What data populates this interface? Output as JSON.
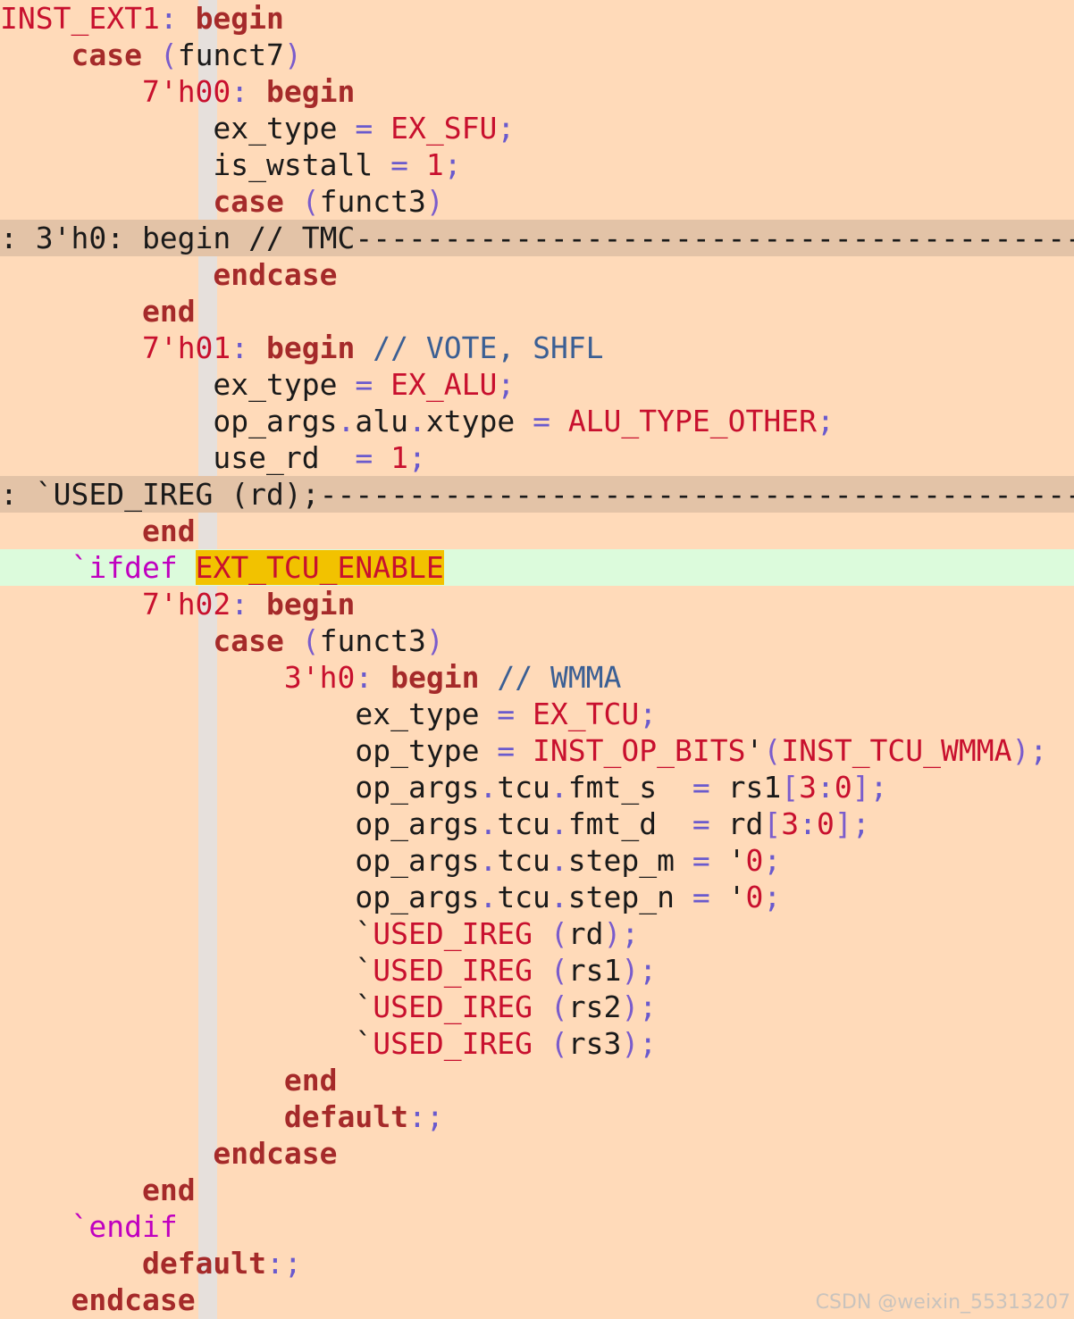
{
  "editor": {
    "watermark": "CSDN @weixin_55313207",
    "lines": [
      {
        "segs": [
          {
            "t": "INST_EXT1",
            "c": "label"
          },
          {
            "t": ": ",
            "c": "op"
          },
          {
            "t": "begin",
            "c": "kw"
          }
        ]
      },
      {
        "segs": [
          {
            "t": "    ",
            "c": "id"
          },
          {
            "t": "case",
            "c": "kw"
          },
          {
            "t": " ",
            "c": "id"
          },
          {
            "t": "(",
            "c": "paren"
          },
          {
            "t": "funct7",
            "c": "id"
          },
          {
            "t": ")",
            "c": "paren"
          }
        ]
      },
      {
        "segs": [
          {
            "t": "        ",
            "c": "id"
          },
          {
            "t": "7'h00",
            "c": "num"
          },
          {
            "t": ": ",
            "c": "op"
          },
          {
            "t": "begin",
            "c": "kw"
          }
        ]
      },
      {
        "segs": [
          {
            "t": "            ",
            "c": "id"
          },
          {
            "t": "ex_type",
            "c": "id"
          },
          {
            "t": " = ",
            "c": "op"
          },
          {
            "t": "EX_SFU",
            "c": "const"
          },
          {
            "t": ";",
            "c": "op"
          }
        ]
      },
      {
        "segs": [
          {
            "t": "            ",
            "c": "id"
          },
          {
            "t": "is_wstall",
            "c": "id"
          },
          {
            "t": " = ",
            "c": "op"
          },
          {
            "t": "1",
            "c": "num"
          },
          {
            "t": ";",
            "c": "op"
          }
        ]
      },
      {
        "segs": [
          {
            "t": "            ",
            "c": "id"
          },
          {
            "t": "case",
            "c": "kw"
          },
          {
            "t": " ",
            "c": "id"
          },
          {
            "t": "(",
            "c": "paren"
          },
          {
            "t": "funct3",
            "c": "id"
          },
          {
            "t": ")",
            "c": "paren"
          }
        ]
      },
      {
        "type": "fold",
        "segs": [
          {
            "t": ": 3'h0: begin // TMC",
            "c": "id"
          },
          {
            "t": "------------------------------------------------------------",
            "c": "id"
          }
        ]
      },
      {
        "segs": [
          {
            "t": "            ",
            "c": "id"
          },
          {
            "t": "endcase",
            "c": "kw"
          }
        ]
      },
      {
        "segs": [
          {
            "t": "        ",
            "c": "id"
          },
          {
            "t": "end",
            "c": "kw"
          }
        ]
      },
      {
        "segs": [
          {
            "t": "        ",
            "c": "id"
          },
          {
            "t": "7'h01",
            "c": "num"
          },
          {
            "t": ": ",
            "c": "op"
          },
          {
            "t": "begin",
            "c": "kw"
          },
          {
            "t": " ",
            "c": "id"
          },
          {
            "t": "// VOTE, SHFL",
            "c": "cmt"
          }
        ]
      },
      {
        "segs": [
          {
            "t": "            ",
            "c": "id"
          },
          {
            "t": "ex_type",
            "c": "id"
          },
          {
            "t": " = ",
            "c": "op"
          },
          {
            "t": "EX_ALU",
            "c": "const"
          },
          {
            "t": ";",
            "c": "op"
          }
        ]
      },
      {
        "segs": [
          {
            "t": "            ",
            "c": "id"
          },
          {
            "t": "op_args",
            "c": "id"
          },
          {
            "t": ".",
            "c": "op"
          },
          {
            "t": "alu",
            "c": "id"
          },
          {
            "t": ".",
            "c": "op"
          },
          {
            "t": "xtype",
            "c": "id"
          },
          {
            "t": " = ",
            "c": "op"
          },
          {
            "t": "ALU_TYPE_OTHER",
            "c": "const"
          },
          {
            "t": ";",
            "c": "op"
          }
        ]
      },
      {
        "segs": [
          {
            "t": "            ",
            "c": "id"
          },
          {
            "t": "use_rd",
            "c": "id"
          },
          {
            "t": "  = ",
            "c": "op"
          },
          {
            "t": "1",
            "c": "num"
          },
          {
            "t": ";",
            "c": "op"
          }
        ]
      },
      {
        "type": "fold",
        "segs": [
          {
            "t": ": `USED_IREG (rd);",
            "c": "id"
          },
          {
            "t": "------------------------------------------------------------",
            "c": "id"
          }
        ]
      },
      {
        "segs": [
          {
            "t": "        ",
            "c": "id"
          },
          {
            "t": "end",
            "c": "kw"
          }
        ]
      },
      {
        "type": "hl",
        "segs": [
          {
            "t": "    ",
            "c": "id"
          },
          {
            "t": "`ifdef",
            "c": "pre"
          },
          {
            "t": " ",
            "c": "id"
          },
          {
            "t": "EXT_TCU_ENABLE",
            "c": "search"
          }
        ]
      },
      {
        "segs": [
          {
            "t": "        ",
            "c": "id"
          },
          {
            "t": "7'h02",
            "c": "num"
          },
          {
            "t": ": ",
            "c": "op"
          },
          {
            "t": "begin",
            "c": "kw"
          }
        ]
      },
      {
        "segs": [
          {
            "t": "            ",
            "c": "id"
          },
          {
            "t": "case",
            "c": "kw"
          },
          {
            "t": " ",
            "c": "id"
          },
          {
            "t": "(",
            "c": "paren"
          },
          {
            "t": "funct3",
            "c": "id"
          },
          {
            "t": ")",
            "c": "paren"
          }
        ]
      },
      {
        "segs": [
          {
            "t": "                ",
            "c": "id"
          },
          {
            "t": "3'h0",
            "c": "num"
          },
          {
            "t": ": ",
            "c": "op"
          },
          {
            "t": "begin",
            "c": "kw"
          },
          {
            "t": " ",
            "c": "id"
          },
          {
            "t": "// WMMA",
            "c": "cmt"
          }
        ]
      },
      {
        "segs": [
          {
            "t": "                    ",
            "c": "id"
          },
          {
            "t": "ex_type",
            "c": "id"
          },
          {
            "t": " = ",
            "c": "op"
          },
          {
            "t": "EX_TCU",
            "c": "const"
          },
          {
            "t": ";",
            "c": "op"
          }
        ]
      },
      {
        "segs": [
          {
            "t": "                    ",
            "c": "id"
          },
          {
            "t": "op_type",
            "c": "id"
          },
          {
            "t": " = ",
            "c": "op"
          },
          {
            "t": "INST_OP_BITS",
            "c": "const"
          },
          {
            "t": "'",
            "c": "id"
          },
          {
            "t": "(",
            "c": "paren"
          },
          {
            "t": "INST_TCU_WMMA",
            "c": "const"
          },
          {
            "t": ")",
            "c": "paren"
          },
          {
            "t": ";",
            "c": "op"
          }
        ]
      },
      {
        "segs": [
          {
            "t": "                    ",
            "c": "id"
          },
          {
            "t": "op_args",
            "c": "id"
          },
          {
            "t": ".",
            "c": "op"
          },
          {
            "t": "tcu",
            "c": "id"
          },
          {
            "t": ".",
            "c": "op"
          },
          {
            "t": "fmt_s",
            "c": "id"
          },
          {
            "t": "  = ",
            "c": "op"
          },
          {
            "t": "rs1",
            "c": "id"
          },
          {
            "t": "[",
            "c": "paren"
          },
          {
            "t": "3",
            "c": "num"
          },
          {
            "t": ":",
            "c": "op"
          },
          {
            "t": "0",
            "c": "num"
          },
          {
            "t": "]",
            "c": "paren"
          },
          {
            "t": ";",
            "c": "op"
          }
        ]
      },
      {
        "segs": [
          {
            "t": "                    ",
            "c": "id"
          },
          {
            "t": "op_args",
            "c": "id"
          },
          {
            "t": ".",
            "c": "op"
          },
          {
            "t": "tcu",
            "c": "id"
          },
          {
            "t": ".",
            "c": "op"
          },
          {
            "t": "fmt_d",
            "c": "id"
          },
          {
            "t": "  = ",
            "c": "op"
          },
          {
            "t": "rd",
            "c": "id"
          },
          {
            "t": "[",
            "c": "paren"
          },
          {
            "t": "3",
            "c": "num"
          },
          {
            "t": ":",
            "c": "op"
          },
          {
            "t": "0",
            "c": "num"
          },
          {
            "t": "]",
            "c": "paren"
          },
          {
            "t": ";",
            "c": "op"
          }
        ]
      },
      {
        "segs": [
          {
            "t": "                    ",
            "c": "id"
          },
          {
            "t": "op_args",
            "c": "id"
          },
          {
            "t": ".",
            "c": "op"
          },
          {
            "t": "tcu",
            "c": "id"
          },
          {
            "t": ".",
            "c": "op"
          },
          {
            "t": "step_m",
            "c": "id"
          },
          {
            "t": " = ",
            "c": "op"
          },
          {
            "t": "'",
            "c": "id"
          },
          {
            "t": "0",
            "c": "num"
          },
          {
            "t": ";",
            "c": "op"
          }
        ]
      },
      {
        "segs": [
          {
            "t": "                    ",
            "c": "id"
          },
          {
            "t": "op_args",
            "c": "id"
          },
          {
            "t": ".",
            "c": "op"
          },
          {
            "t": "tcu",
            "c": "id"
          },
          {
            "t": ".",
            "c": "op"
          },
          {
            "t": "step_n",
            "c": "id"
          },
          {
            "t": " = ",
            "c": "op"
          },
          {
            "t": "'",
            "c": "id"
          },
          {
            "t": "0",
            "c": "num"
          },
          {
            "t": ";",
            "c": "op"
          }
        ]
      },
      {
        "segs": [
          {
            "t": "                    ",
            "c": "id"
          },
          {
            "t": "`",
            "c": "id"
          },
          {
            "t": "USED_IREG",
            "c": "const"
          },
          {
            "t": " ",
            "c": "id"
          },
          {
            "t": "(",
            "c": "paren"
          },
          {
            "t": "rd",
            "c": "id"
          },
          {
            "t": ")",
            "c": "paren"
          },
          {
            "t": ";",
            "c": "op"
          }
        ]
      },
      {
        "segs": [
          {
            "t": "                    ",
            "c": "id"
          },
          {
            "t": "`",
            "c": "id"
          },
          {
            "t": "USED_IREG",
            "c": "const"
          },
          {
            "t": " ",
            "c": "id"
          },
          {
            "t": "(",
            "c": "paren"
          },
          {
            "t": "rs1",
            "c": "id"
          },
          {
            "t": ")",
            "c": "paren"
          },
          {
            "t": ";",
            "c": "op"
          }
        ]
      },
      {
        "segs": [
          {
            "t": "                    ",
            "c": "id"
          },
          {
            "t": "`",
            "c": "id"
          },
          {
            "t": "USED_IREG",
            "c": "const"
          },
          {
            "t": " ",
            "c": "id"
          },
          {
            "t": "(",
            "c": "paren"
          },
          {
            "t": "rs2",
            "c": "id"
          },
          {
            "t": ")",
            "c": "paren"
          },
          {
            "t": ";",
            "c": "op"
          }
        ]
      },
      {
        "segs": [
          {
            "t": "                    ",
            "c": "id"
          },
          {
            "t": "`",
            "c": "id"
          },
          {
            "t": "USED_IREG",
            "c": "const"
          },
          {
            "t": " ",
            "c": "id"
          },
          {
            "t": "(",
            "c": "paren"
          },
          {
            "t": "rs3",
            "c": "id"
          },
          {
            "t": ")",
            "c": "paren"
          },
          {
            "t": ";",
            "c": "op"
          }
        ]
      },
      {
        "segs": [
          {
            "t": "                ",
            "c": "id"
          },
          {
            "t": "end",
            "c": "kw"
          }
        ]
      },
      {
        "segs": [
          {
            "t": "                ",
            "c": "id"
          },
          {
            "t": "default",
            "c": "kw"
          },
          {
            "t": ":;",
            "c": "op"
          }
        ]
      },
      {
        "segs": [
          {
            "t": "            ",
            "c": "id"
          },
          {
            "t": "endcase",
            "c": "kw"
          }
        ]
      },
      {
        "segs": [
          {
            "t": "        ",
            "c": "id"
          },
          {
            "t": "end",
            "c": "kw"
          }
        ]
      },
      {
        "segs": [
          {
            "t": "    ",
            "c": "id"
          },
          {
            "t": "`endif",
            "c": "pre"
          }
        ]
      },
      {
        "segs": [
          {
            "t": "        ",
            "c": "id"
          },
          {
            "t": "default",
            "c": "kw"
          },
          {
            "t": ":;",
            "c": "op"
          }
        ]
      },
      {
        "segs": [
          {
            "t": "    ",
            "c": "id"
          },
          {
            "t": "endcase",
            "c": "kw"
          }
        ]
      }
    ]
  }
}
